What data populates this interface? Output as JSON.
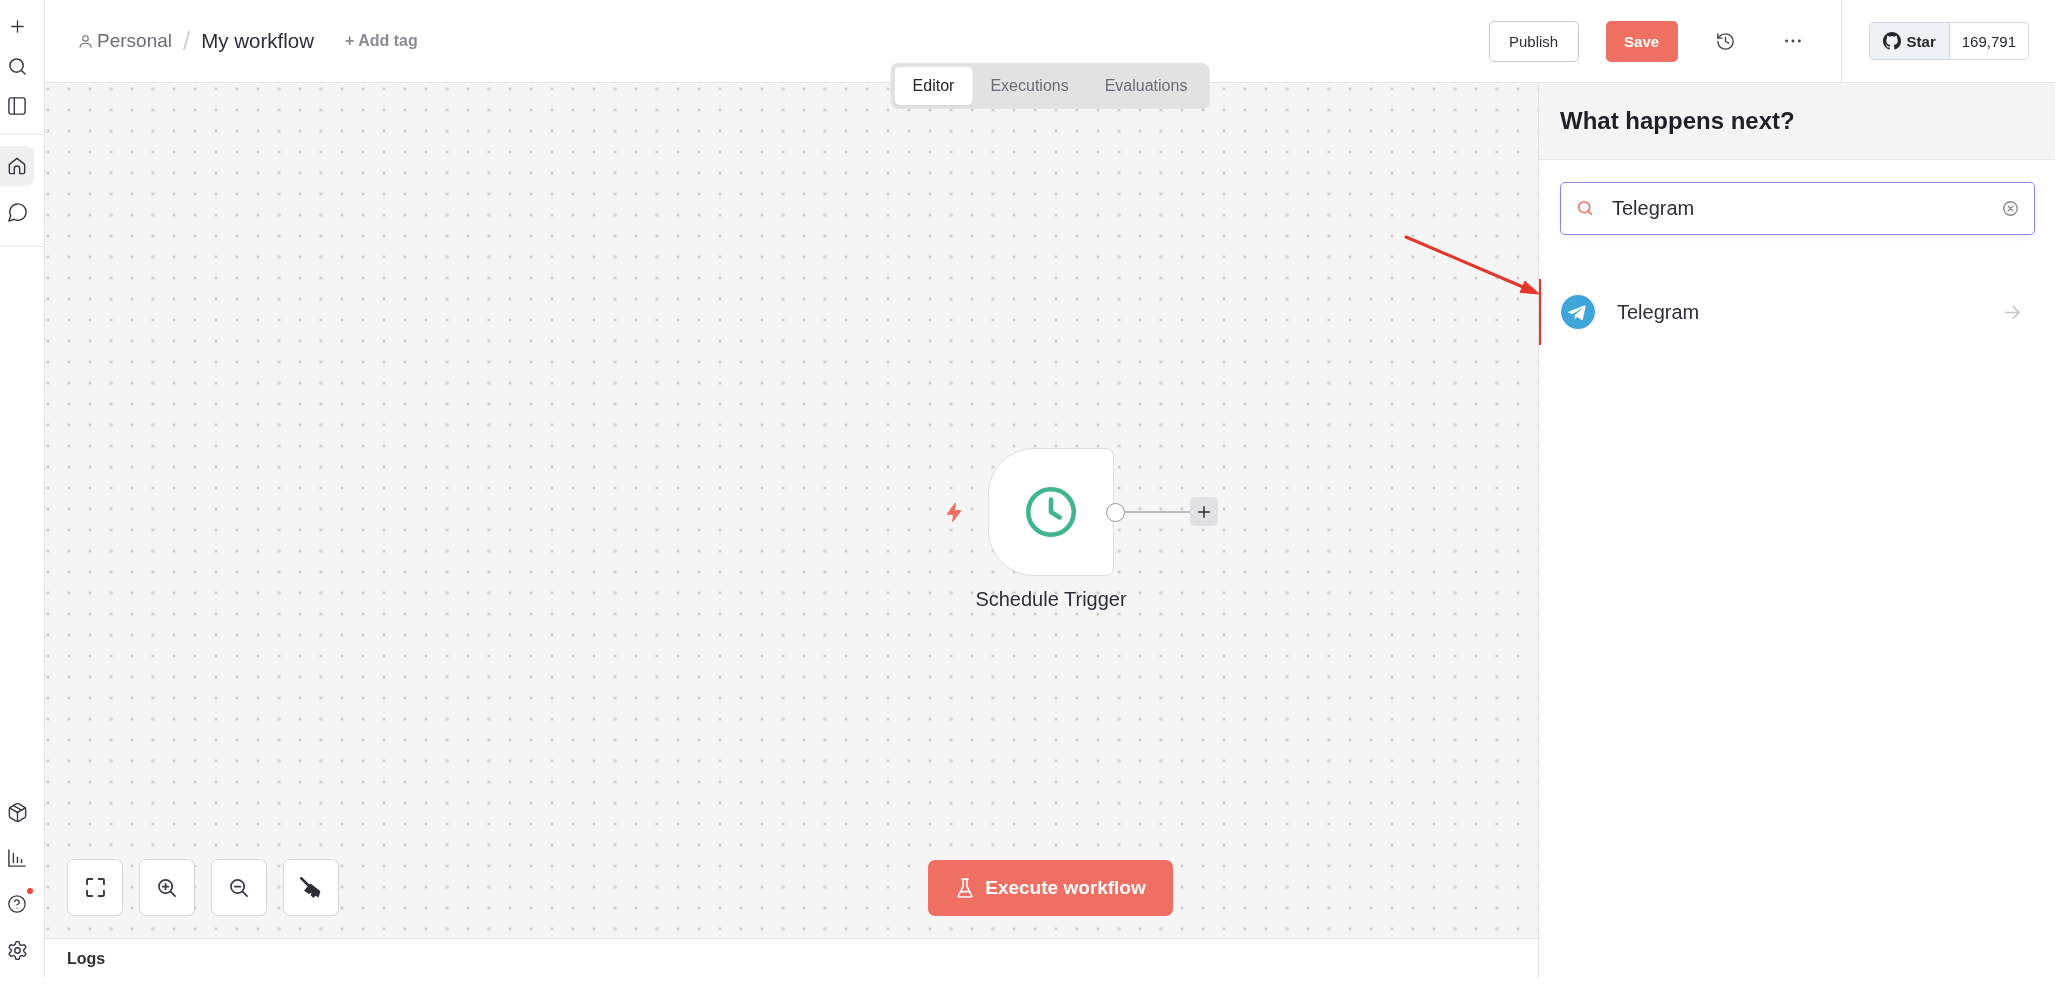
{
  "sidebar": {
    "nav_items": [
      {
        "selected": true
      },
      {
        "selected": false
      }
    ],
    "bottom_items": [
      {
        "notification": false
      },
      {
        "notification": false
      },
      {
        "notification": true
      },
      {
        "notification": false
      }
    ]
  },
  "header": {
    "project": "Personal",
    "separator": "/",
    "workflow": "My workflow",
    "add_tag": "+ Add tag",
    "publish_button": "Publish",
    "save_button": "Save",
    "github_star": {
      "label": "Star",
      "count": "169,791"
    }
  },
  "tabs": [
    {
      "label": "Editor",
      "selected": true
    },
    {
      "label": "Executions",
      "selected": false
    },
    {
      "label": "Evaluations",
      "selected": false
    }
  ],
  "canvas": {
    "nodes": [
      {
        "name": "Schedule Trigger",
        "trigger": true
      }
    ],
    "execute_button": "Execute workflow"
  },
  "logs": {
    "title": "Logs"
  },
  "node_creator": {
    "title": "What happens next?",
    "search": {
      "value": "Telegram"
    },
    "results": [
      {
        "label": "Telegram",
        "selected": true
      }
    ]
  }
}
